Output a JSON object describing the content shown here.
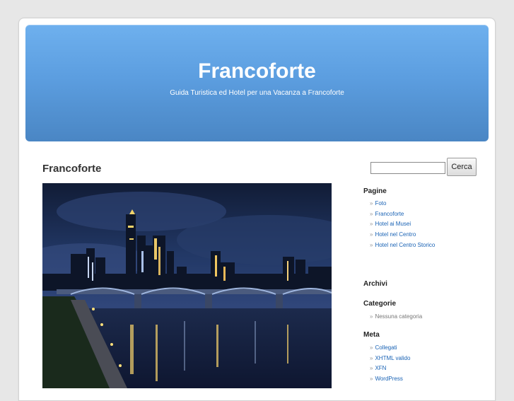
{
  "header": {
    "title": "Francoforte",
    "description": "Guida Turistica ed Hotel per una Vacanza a Francoforte"
  },
  "post": {
    "title": "Francoforte",
    "image_alt": "Skyline di Francoforte di notte"
  },
  "search": {
    "placeholder": "",
    "button_label": "Cerca"
  },
  "sidebar": {
    "bullet": "»",
    "pages_heading": "Pagine",
    "pages": [
      {
        "label": "Foto"
      },
      {
        "label": "Francoforte"
      },
      {
        "label": "Hotel ai Musei"
      },
      {
        "label": "Hotel nel Centro"
      },
      {
        "label": "Hotel nel Centro Storico"
      }
    ],
    "archives_heading": "Archivi",
    "categories_heading": "Categorie",
    "categories": [
      {
        "label": "Nessuna categoria"
      }
    ],
    "meta_heading": "Meta",
    "meta": [
      {
        "label": "Collegati"
      },
      {
        "label": "XHTML valido"
      },
      {
        "label": "XFN"
      },
      {
        "label": "WordPress"
      }
    ]
  },
  "colors": {
    "background": "#e7e7e7",
    "header_top": "#6eb0ee",
    "header_bottom": "#4a86c4",
    "link": "#1a63b5"
  }
}
